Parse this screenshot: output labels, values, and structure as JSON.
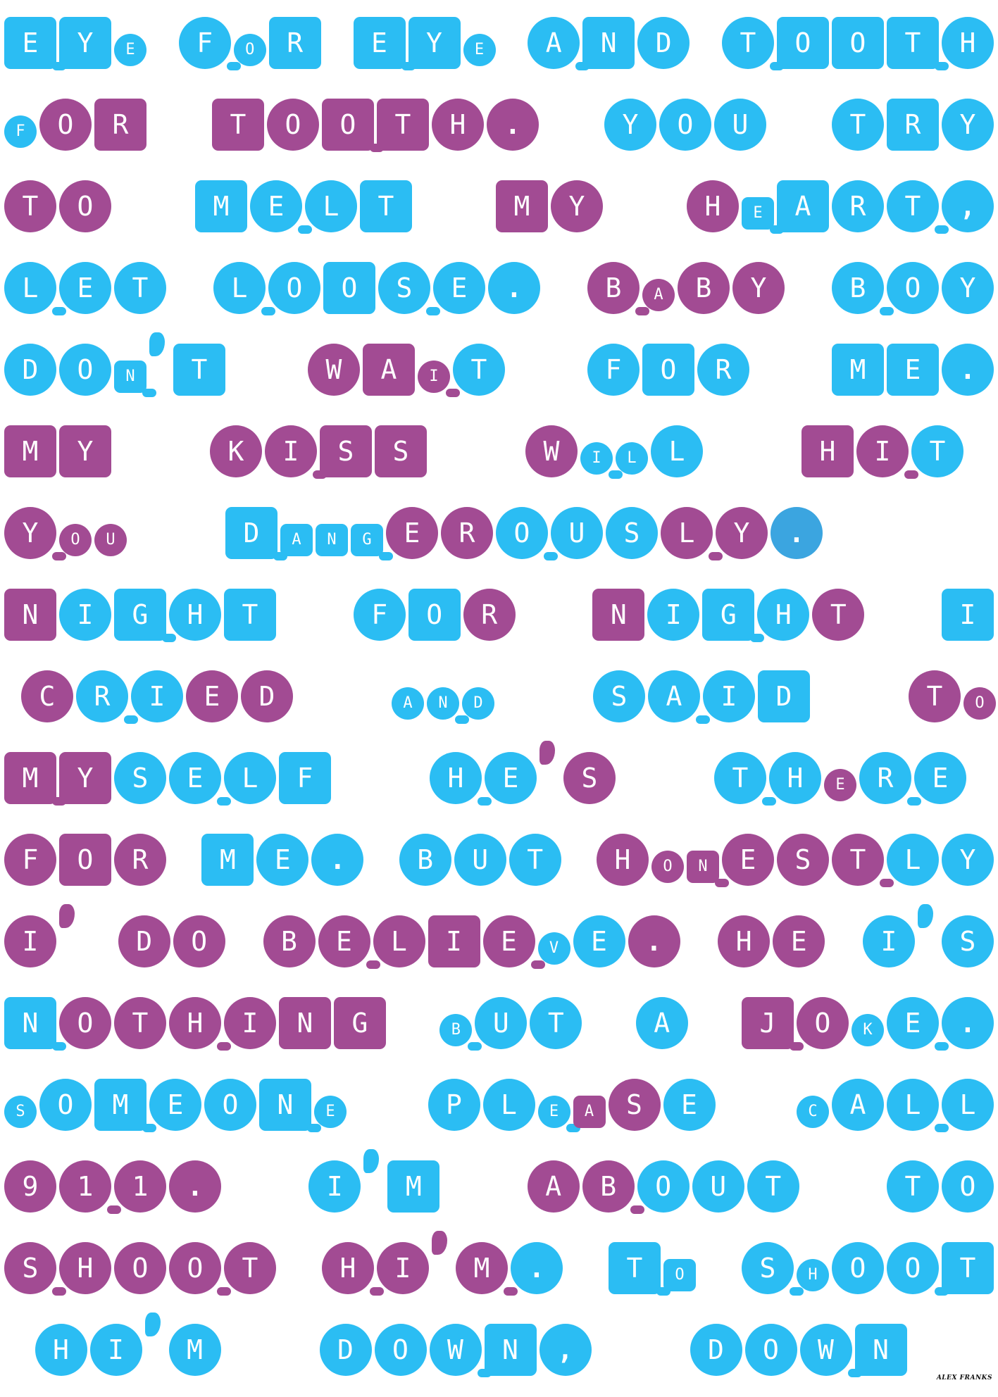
{
  "colors": {
    "blue": "#2bbdf3",
    "purple": "#a24b93",
    "dot_blue": "#3ba5e0",
    "background": "#ffffff"
  },
  "poster": {
    "lines": [
      [
        {
          "text": "EYE",
          "c": "bbb",
          "s": "ssr",
          "small": "..s"
        },
        {
          "text": "FOR",
          "c": "bbb",
          "s": "rrs",
          "small": ".s."
        },
        {
          "text": "EYE",
          "c": "bbb",
          "s": "ssr",
          "small": "..s"
        },
        {
          "text": "AND",
          "c": "bbb",
          "s": "rsr",
          "small": "..."
        },
        {
          "text": "TOOTH",
          "c": "bbbbb",
          "s": "rsssr",
          "small": "....."
        }
      ],
      [
        {
          "text": "FOR",
          "c": "bpp",
          "s": "rrs",
          "small": "s.."
        },
        {
          "text": "TOOTH.",
          "c": "pppppp",
          "s": "srssrr",
          "small": "......"
        },
        {
          "text": "YOU",
          "c": "bbb",
          "s": "rrr",
          "small": "..."
        },
        {
          "text": "TRY",
          "c": "bbb",
          "s": "rsr",
          "small": "..."
        }
      ],
      [
        {
          "text": "TO",
          "c": "pp",
          "s": "rr",
          "small": ".."
        },
        {
          "text": "MELT",
          "c": "bbbb",
          "s": "srrs",
          "small": "...."
        },
        {
          "text": "MY",
          "c": "pp",
          "s": "sr",
          "small": ".."
        },
        {
          "text": "HEART,",
          "c": "pbbbbb",
          "s": "rssrrr",
          "small": ".s...."
        }
      ],
      [
        {
          "text": "LET",
          "c": "bbb",
          "s": "rrr",
          "small": "..."
        },
        {
          "text": "LOOSE.",
          "c": "bbbbbb",
          "s": "rrsrrr",
          "small": "......"
        },
        {
          "text": "BABY",
          "c": "pppp",
          "s": "rrrr",
          "small": ".s.."
        },
        {
          "text": "BOY",
          "c": "bbb",
          "s": "rrr",
          "small": "..."
        }
      ],
      [
        {
          "text": "DON'T",
          "c": "bbbbb",
          "s": "rrsrs",
          "small": "..s.."
        },
        {
          "text": "WAIT",
          "c": "pppb",
          "s": "rsrr",
          "small": "..s."
        },
        {
          "text": "FOR",
          "c": "bbb",
          "s": "rsr",
          "small": "..."
        },
        {
          "text": "ME.",
          "c": "bbb",
          "s": "ssr",
          "small": "..."
        }
      ],
      [
        {
          "text": "MY",
          "c": "pp",
          "s": "ss",
          "small": ".."
        },
        {
          "text": "KISS",
          "c": "pppp",
          "s": "rrss",
          "small": "...."
        },
        {
          "text": "WILL",
          "c": "pbbb",
          "s": "rrrr",
          "small": ".ss."
        },
        {
          "text": "HIT",
          "c": "ppb",
          "s": "srr",
          "small": "..."
        }
      ],
      [
        {
          "text": "YOU",
          "c": "ppp",
          "s": "rrr",
          "small": ".ss"
        },
        {
          "text": "DANGEROUSLY.",
          "c": "bbbbppbbbpp.",
          "s": "ssssrrrrrrrr",
          "small": ".sss........"
        }
      ],
      [
        {
          "text": "NIGHT",
          "c": "pbbbb",
          "s": "srsrs",
          "small": "....."
        },
        {
          "text": "FOR",
          "c": "bbp",
          "s": "rsr",
          "small": "..."
        },
        {
          "text": "NIGHT",
          "c": "pbbbp",
          "s": "srsrr",
          "small": "....."
        },
        {
          "text": "I",
          "c": "b",
          "s": "s",
          "small": "."
        }
      ],
      [
        {
          "text": "CRIED",
          "c": "pbbpp",
          "s": "rrrrr",
          "small": "....."
        },
        {
          "text": "AND",
          "c": "bbb",
          "s": "rrr",
          "small": "sss"
        },
        {
          "text": "SAID",
          "c": "bbbb",
          "s": "rrrs",
          "small": "...."
        },
        {
          "text": "TO",
          "c": "pp",
          "s": "rr",
          "small": ".s"
        }
      ],
      [
        {
          "text": "MYSELF",
          "c": "ppbbbb",
          "s": "ssrrrs",
          "small": "......"
        },
        {
          "text": "HE'S",
          "c": "bbpp",
          "s": "rrrr",
          "small": "...."
        },
        {
          "text": "THERE",
          "c": "bbpbb",
          "s": "rrrrr",
          "small": "..s.."
        },
        {
          "text": "",
          "c": "",
          "s": "",
          "small": ""
        }
      ],
      [
        {
          "text": "FOR",
          "c": "ppp",
          "s": "rsr",
          "small": "..."
        },
        {
          "text": "ME.",
          "c": "bbb",
          "s": "srr",
          "small": "..."
        },
        {
          "text": "BUT",
          "c": "bbb",
          "s": "rrr",
          "small": "..."
        },
        {
          "text": "HONESTLY",
          "c": "ppppppbb",
          "s": "rrsrrrrr",
          "small": ".ss....."
        }
      ],
      [
        {
          "text": "I'",
          "c": "pp",
          "s": "rr",
          "small": ".s"
        },
        {
          "text": "DO",
          "c": "pp",
          "s": "rr",
          "small": ".."
        },
        {
          "text": "BELIEVE.",
          "c": "pppppbbp",
          "s": "rrrsrrrr",
          "small": ".....s.."
        },
        {
          "text": "HE",
          "c": "pp",
          "s": "rr",
          "small": ".."
        },
        {
          "text": "I'S",
          "c": "bbb",
          "s": "rrr",
          "small": "..."
        }
      ],
      [
        {
          "text": "NOTHING",
          "c": "bpppppp",
          "s": "srrrrss",
          "small": "......."
        },
        {
          "text": "BUT",
          "c": "bbb",
          "s": "rrr",
          "small": "s.."
        },
        {
          "text": "A",
          "c": "b",
          "s": "r",
          "small": "."
        },
        {
          "text": "JOKE.",
          "c": "ppbbb",
          "s": "srrrr",
          "small": "..s.."
        }
      ],
      [
        {
          "text": "SOMEONE",
          "c": "bbbbbbb",
          "s": "rrsrrsr",
          "small": "s.....s"
        },
        {
          "text": "PLEASE",
          "c": "bbbppb",
          "s": "rrrsrr",
          "small": "..ss.."
        },
        {
          "text": "CALL",
          "c": "bbbb",
          "s": "rrrr",
          "small": "s..."
        }
      ],
      [
        {
          "text": "911.",
          "c": "pppp",
          "s": "rrrr",
          "small": "...."
        },
        {
          "text": "I'M",
          "c": "bbb",
          "s": "rrs",
          "small": "..."
        },
        {
          "text": "ABOUT",
          "c": "ppbbb",
          "s": "rrrrr",
          "small": "....."
        },
        {
          "text": "TO",
          "c": "bb",
          "s": "rr",
          "small": ".."
        }
      ],
      [
        {
          "text": "SHOOT",
          "c": "ppppp",
          "s": "rrrrr",
          "small": "....."
        },
        {
          "text": "HI'M.",
          "c": "pppp",
          "s": "rrsr",
          "small": "...."
        },
        {
          "text": "TO",
          "c": "bb",
          "s": "ss",
          "small": ".s"
        },
        {
          "text": "SHOOT",
          "c": "bbbbb",
          "s": "rrrrs",
          "small": ".s..."
        }
      ],
      [
        {
          "text": "HI'M",
          "c": "bbb",
          "s": "rrs",
          "small": "..."
        },
        {
          "text": "DOWN,",
          "c": "bbbbb",
          "s": "rrrsr",
          "small": "....."
        },
        {
          "text": "DOWN",
          "c": "bbbb",
          "s": "rrrs",
          "small": "...."
        }
      ]
    ],
    "signature": "ALEX FRANKS"
  }
}
